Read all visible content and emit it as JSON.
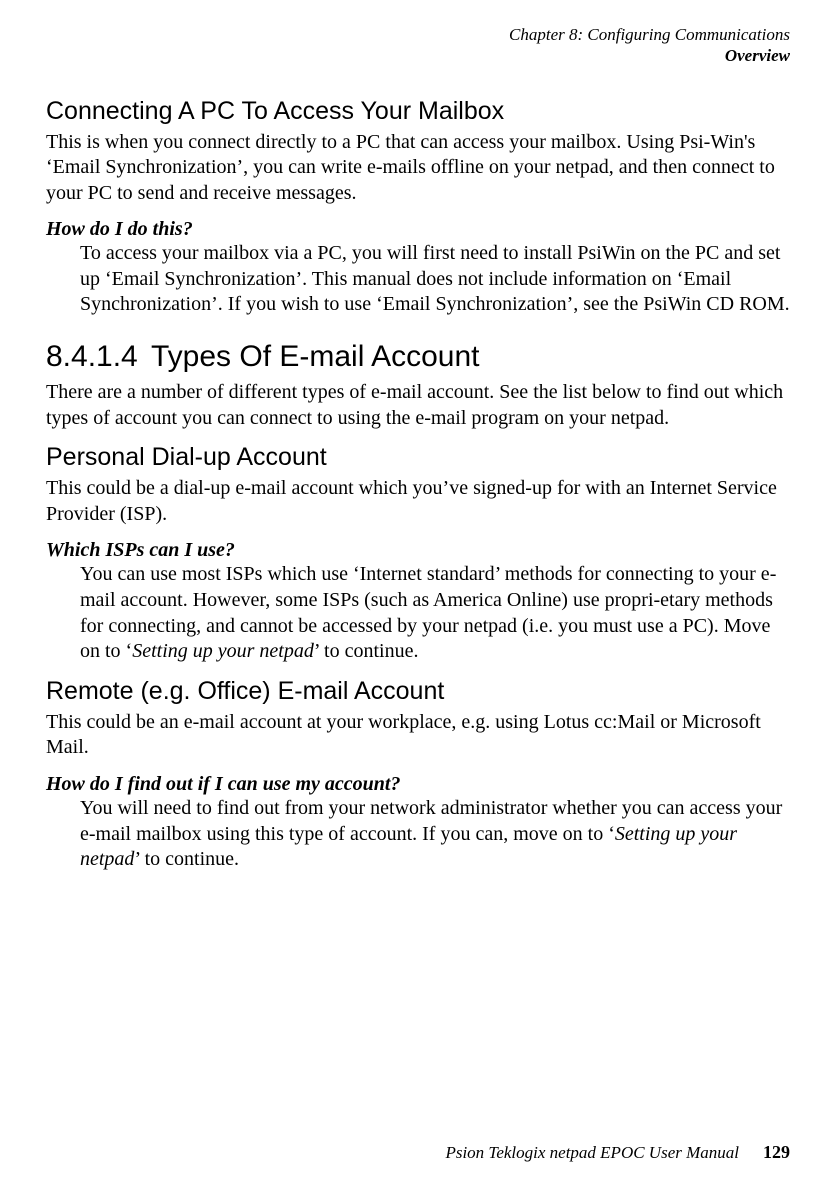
{
  "header": {
    "chapter": "Chapter 8:  Configuring Communications",
    "section": "Overview"
  },
  "s1": {
    "title": "Connecting A PC To Access Your Mailbox",
    "body": "This is when you connect directly to a PC that can access your mailbox. Using Psi-Win's ‘Email Synchronization’, you can write e-mails offline on your netpad, and then connect to your PC to send and receive messages.",
    "q": "How do I do this?",
    "a": "To access your mailbox via a PC, you will first need to install PsiWin on the PC and set up ‘Email Synchronization’. This manual does not include information on ‘Email Synchronization’. If you wish to use ‘Email Synchronization’, see the PsiWin CD ROM."
  },
  "s2": {
    "num": "8.4.1.4",
    "title": "Types Of E-mail Account",
    "body": "There are a number of different types of e-mail account. See the list below to find out which types of account you can connect to using the e-mail program on your netpad."
  },
  "s3": {
    "title": "Personal Dial-up Account",
    "body": "This could be a dial-up e-mail account which you’ve signed-up for with an Internet Service Provider (ISP).",
    "q": "Which ISPs can I use?",
    "a_pre": "You can use most ISPs which use ‘Internet standard’ methods for connecting to your e-mail account. However, some ISPs (such as America Online) use propri-etary methods for connecting, and cannot be accessed by your netpad (i.e. you must use a PC). Move on to ‘",
    "a_ital": "Setting up your netpad",
    "a_post": "’ to continue."
  },
  "s4": {
    "title": "Remote (e.g. Office) E-mail Account",
    "body": "This could be an e-mail account at your workplace, e.g. using Lotus cc:Mail or Microsoft Mail.",
    "q": "How do I find out if I can use my account?",
    "a_pre": "You will need to find out from your network administrator whether you can access your e-mail mailbox using this type of account. If you can, move on to ‘",
    "a_ital": "Setting up your netpad",
    "a_post": "’ to continue."
  },
  "footer": {
    "text": "Psion Teklogix netpad EPOC User Manual",
    "page": "129"
  }
}
